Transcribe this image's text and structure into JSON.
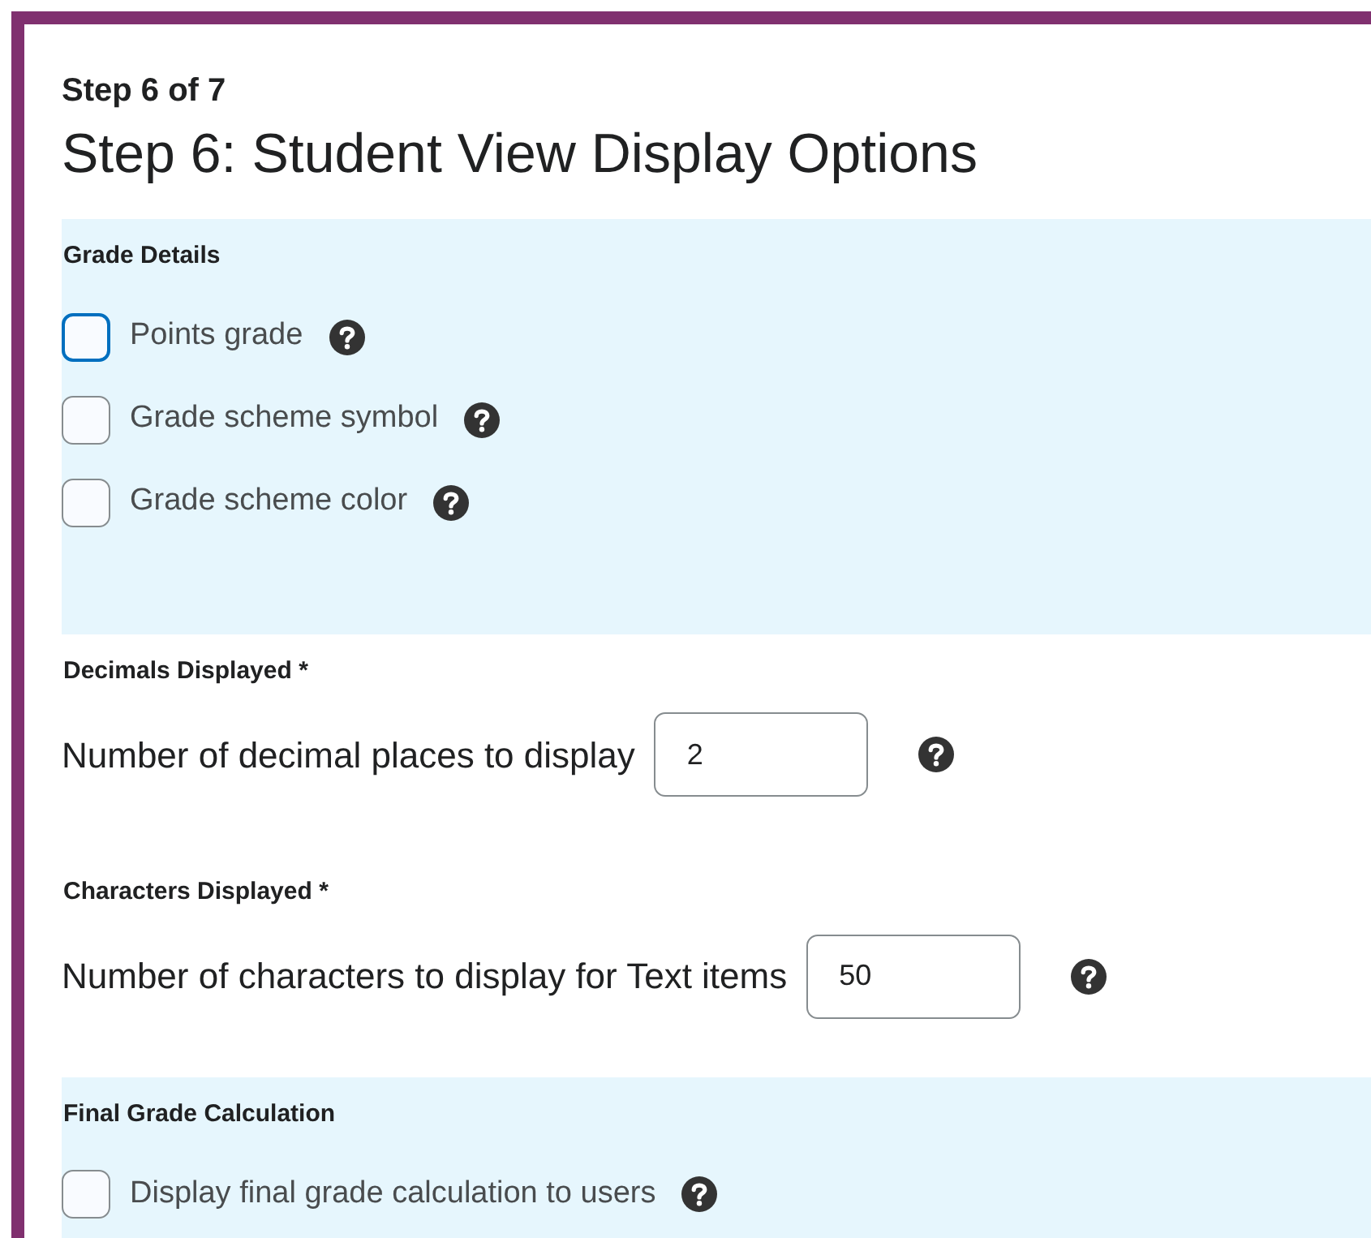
{
  "step_label": "Step 6 of 7",
  "title": "Step 6: Student View Display Options",
  "sections": [
    {
      "kind": "checkboxes",
      "heading": "Grade Details",
      "shaded": true,
      "items": [
        {
          "label": "Points grade",
          "checked": false,
          "focused": true
        },
        {
          "label": "Grade scheme symbol",
          "checked": false,
          "focused": false
        },
        {
          "label": "Grade scheme color",
          "checked": false,
          "focused": false
        }
      ]
    },
    {
      "kind": "number",
      "heading": "Decimals Displayed *",
      "shaded": false,
      "label": "Number of decimal places to display",
      "value": "2"
    },
    {
      "kind": "number",
      "heading": "Characters Displayed *",
      "shaded": false,
      "label": "Number of characters to display for Text items",
      "value": "50"
    },
    {
      "kind": "checkboxes",
      "heading": "Final Grade Calculation",
      "shaded": true,
      "items": [
        {
          "label": "Display final grade calculation to users",
          "checked": false,
          "focused": false
        }
      ]
    }
  ]
}
